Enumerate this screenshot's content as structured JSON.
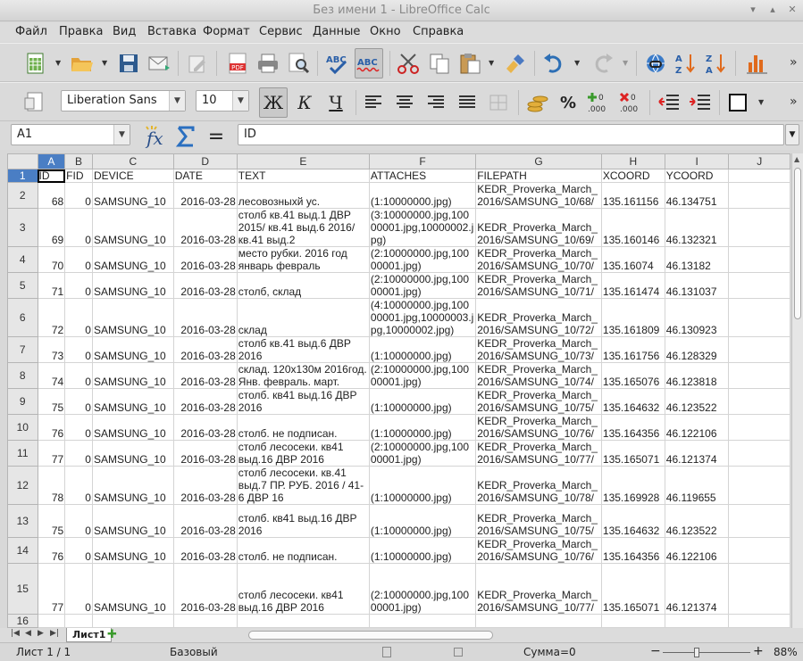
{
  "window": {
    "title": "Без имени 1 - LibreOffice Calc"
  },
  "menu": [
    "Файл",
    "Правка",
    "Вид",
    "Вставка",
    "Формат",
    "Сервис",
    "Данные",
    "Окно",
    "Справка"
  ],
  "format": {
    "font_name": "Liberation Sans",
    "font_size": "10",
    "bold_label": "Ж",
    "italic_label": "К",
    "underline_label": "Ч"
  },
  "formula_bar": {
    "cell_ref": "A1",
    "content": "ID"
  },
  "columns": [
    "A",
    "B",
    "C",
    "D",
    "E",
    "F",
    "G",
    "H",
    "I",
    "J"
  ],
  "rows": [
    {
      "n": "1",
      "c": [
        "ID",
        "FID",
        "DEVICE",
        "DATE",
        "TEXT",
        "ATTACHES",
        "FILEPATH",
        "XCOORD",
        "YCOORD"
      ]
    },
    {
      "n": "2",
      "c": [
        "68",
        "0",
        "SAMSUNG_10",
        "2016-03-28",
        "лесовозныхй ус.",
        "(1:10000000.jpg)",
        "KEDR_Proverka_March_2016/SAMSUNG_10/68/",
        "135.161156",
        "46.134751"
      ]
    },
    {
      "n": "3",
      "c": [
        "69",
        "0",
        "SAMSUNG_10",
        "2016-03-28",
        "столб кв.41 выд.1 ДВР 2015/ кв.41 выд.6 2016/ кв.41 выд.2",
        "(3:10000000.jpg,10000001.jpg,10000002.jpg)",
        "KEDR_Proverka_March_2016/SAMSUNG_10/69/",
        "135.160146",
        "46.132321"
      ]
    },
    {
      "n": "4",
      "c": [
        "70",
        "0",
        "SAMSUNG_10",
        "2016-03-28",
        "место рубки. 2016 год январь февраль",
        "(2:10000000.jpg,10000001.jpg)",
        "KEDR_Proverka_March_2016/SAMSUNG_10/70/",
        "135.16074",
        "46.13182"
      ]
    },
    {
      "n": "5",
      "c": [
        "71",
        "0",
        "SAMSUNG_10",
        "2016-03-28",
        "столб, склад",
        "(2:10000000.jpg,10000001.jpg)",
        "KEDR_Proverka_March_2016/SAMSUNG_10/71/",
        "135.161474",
        "46.131037"
      ]
    },
    {
      "n": "6",
      "c": [
        "72",
        "0",
        "SAMSUNG_10",
        "2016-03-28",
        "склад",
        "(4:10000000.jpg,10000001.jpg,10000003.jpg,10000002.jpg)",
        "KEDR_Proverka_March_2016/SAMSUNG_10/72/",
        "135.161809",
        "46.130923"
      ]
    },
    {
      "n": "7",
      "c": [
        "73",
        "0",
        "SAMSUNG_10",
        "2016-03-28",
        "столб кв.41 выд.6 ДВР 2016",
        "(1:10000000.jpg)",
        "KEDR_Proverka_March_2016/SAMSUNG_10/73/",
        "135.161756",
        "46.128329"
      ]
    },
    {
      "n": "8",
      "c": [
        "74",
        "0",
        "SAMSUNG_10",
        "2016-03-28",
        "склад. 120х130м 2016год. Янв. февраль. март.",
        "(2:10000000.jpg,10000001.jpg)",
        "KEDR_Proverka_March_2016/SAMSUNG_10/74/",
        "135.165076",
        "46.123818"
      ]
    },
    {
      "n": "9",
      "c": [
        "75",
        "0",
        "SAMSUNG_10",
        "2016-03-28",
        "столб. кв41 выд.16 ДВР 2016",
        "(1:10000000.jpg)",
        "KEDR_Proverka_March_2016/SAMSUNG_10/75/",
        "135.164632",
        "46.123522"
      ]
    },
    {
      "n": "10",
      "c": [
        "76",
        "0",
        "SAMSUNG_10",
        "2016-03-28",
        "столб. не подписан.",
        "(1:10000000.jpg)",
        "KEDR_Proverka_March_2016/SAMSUNG_10/76/",
        "135.164356",
        "46.122106"
      ]
    },
    {
      "n": "11",
      "c": [
        "77",
        "0",
        "SAMSUNG_10",
        "2016-03-28",
        "столб лесосеки. кв41 выд.16 ДВР 2016",
        "(2:10000000.jpg,10000001.jpg)",
        "KEDR_Proverka_March_2016/SAMSUNG_10/77/",
        "135.165071",
        "46.121374"
      ]
    },
    {
      "n": "12",
      "c": [
        "78",
        "0",
        "SAMSUNG_10",
        "2016-03-28",
        "столб лесосеки. кв.41 выд.7 ПР. РУБ. 2016 / 41-6 ДВР 16",
        "(1:10000000.jpg)",
        "KEDR_Proverka_March_2016/SAMSUNG_10/78/",
        "135.169928",
        "46.119655"
      ]
    },
    {
      "n": "13",
      "c": [
        "75",
        "0",
        "SAMSUNG_10",
        "2016-03-28",
        "столб. кв41 выд.16 ДВР 2016",
        "(1:10000000.jpg)",
        "KEDR_Proverka_March_2016/SAMSUNG_10/75/",
        "135.164632",
        "46.123522"
      ]
    },
    {
      "n": "14",
      "c": [
        "76",
        "0",
        "SAMSUNG_10",
        "2016-03-28",
        "столб. не подписан.",
        "(1:10000000.jpg)",
        "KEDR_Proverka_March_2016/SAMSUNG_10/76/",
        "135.164356",
        "46.122106"
      ]
    },
    {
      "n": "15",
      "c": [
        "77",
        "0",
        "SAMSUNG_10",
        "2016-03-28",
        "столб лесосеки. кв41 выд.16 ДВР 2016",
        "(2:10000000.jpg,10000001.jpg)",
        "KEDR_Proverka_March_2016/SAMSUNG_10/77/",
        "135.165071",
        "46.121374"
      ]
    },
    {
      "n": "16",
      "c": [
        "",
        "",
        "",
        "",
        "",
        "",
        "",
        "",
        ""
      ]
    }
  ],
  "sheet_tabs": [
    "Лист1"
  ],
  "status": {
    "sheet": "Лист 1 / 1",
    "style": "Базовый",
    "sum": "Сумма=0",
    "zoom": "88%"
  }
}
